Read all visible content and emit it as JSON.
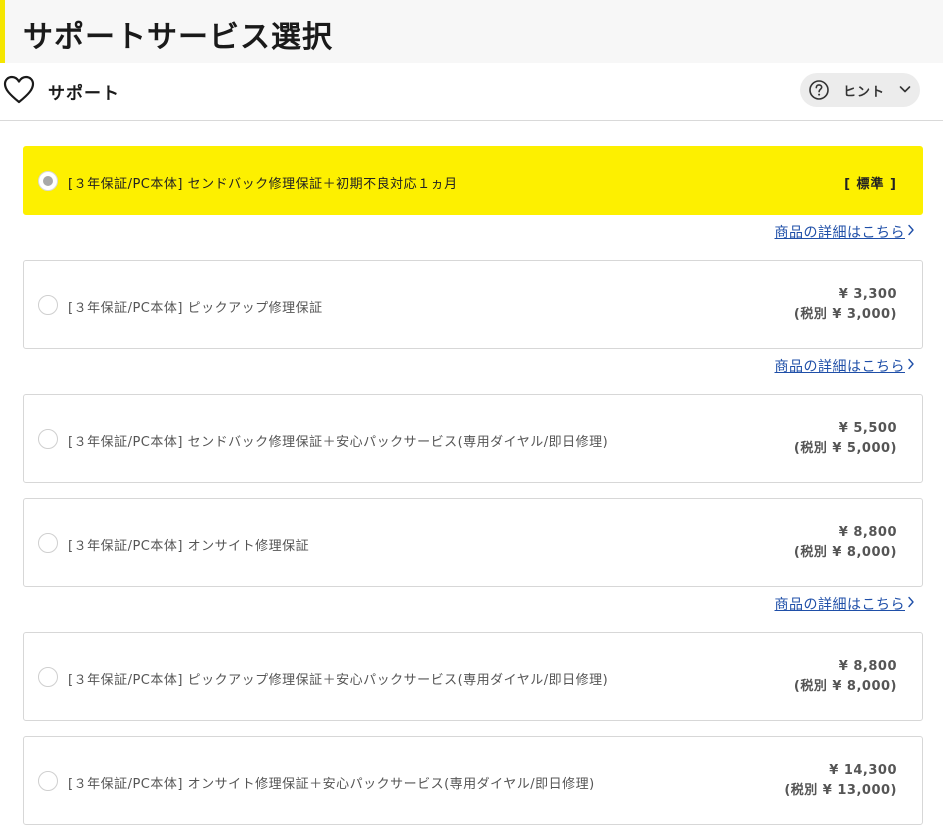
{
  "page": {
    "title": "サポートサービス選択"
  },
  "sub_header": {
    "title": "サポート",
    "hint_label": "ヒント"
  },
  "detail_link_text": "商品の詳細はこちら",
  "options": [
    {
      "label": "[３年保証/PC本体] センドバック修理保証＋初期不良対応１ヵ月",
      "badge": "[ 標準 ]",
      "selected": true
    },
    {
      "label": "[３年保証/PC本体] ピックアップ修理保証",
      "price": "¥ 3,300",
      "price_tax_excluded": "(税別 ¥ 3,000)",
      "selected": false
    },
    {
      "label": "[３年保証/PC本体] センドバック修理保証＋安心パックサービス(専用ダイヤル/即日修理)",
      "price": "¥ 5,500",
      "price_tax_excluded": "(税別 ¥ 5,000)",
      "selected": false
    },
    {
      "label": "[３年保証/PC本体] オンサイト修理保証",
      "price": "¥ 8,800",
      "price_tax_excluded": "(税別 ¥ 8,000)",
      "selected": false
    },
    {
      "label": "[３年保証/PC本体] ピックアップ修理保証＋安心パックサービス(専用ダイヤル/即日修理)",
      "price": "¥ 8,800",
      "price_tax_excluded": "(税別 ¥ 8,000)",
      "selected": false
    },
    {
      "label": "[３年保証/PC本体] オンサイト修理保証＋安心パックサービス(専用ダイヤル/即日修理)",
      "price": "¥ 14,300",
      "price_tax_excluded": "(税別 ¥ 13,000)",
      "selected": false
    }
  ],
  "colors": {
    "selected_background": "#fdf000",
    "header_accent": "#f5e600",
    "link": "#1f4fa8"
  }
}
